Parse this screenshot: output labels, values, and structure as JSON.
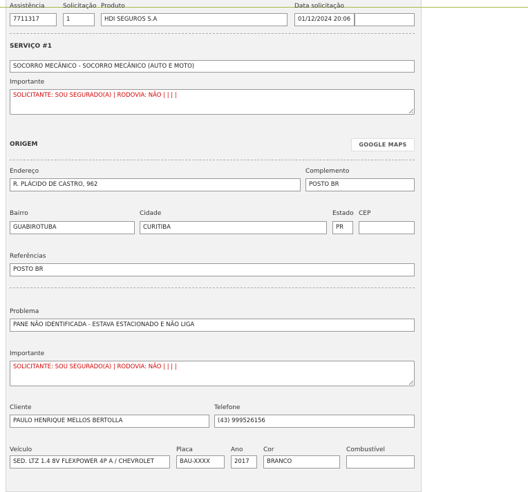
{
  "header": {
    "assistencia_label": "Assistência",
    "assistencia": "7711317",
    "solicitacao_label": "Solicitação",
    "solicitacao": "1",
    "produto_label": "Produto",
    "produto": "HDI SEGUROS S.A",
    "data_label": "Data solicitação",
    "data": "01/12/2024 20:06",
    "extra": ""
  },
  "servico": {
    "title": "SERVIÇO #1",
    "value": "SOCORRO MECÂNICO - SOCORRO MECÂNICO (AUTO E MOTO)",
    "importante_label": "Importante",
    "importante": "SOLICITANTE: SOU SEGURADO(A) | RODOVIA: NÃO |  |  |  |"
  },
  "origem": {
    "title": "ORIGEM",
    "maps_button": "GOOGLE MAPS",
    "endereco_label": "Endereço",
    "endereco": "R. PLÁCIDO DE CASTRO, 962",
    "complemento_label": "Complemento",
    "complemento": "POSTO BR",
    "bairro_label": "Bairro",
    "bairro": "GUABIROTUBA",
    "cidade_label": "Cidade",
    "cidade": "CURITIBA",
    "estado_label": "Estado",
    "estado": "PR",
    "cep_label": "CEP",
    "cep": "",
    "referencias_label": "Referências",
    "referencias": "POSTO BR"
  },
  "detalhes": {
    "problema_label": "Problema",
    "problema": "PANE NÃO IDENTIFICADA - ESTAVA ESTACIONADO E NÃO LIGA",
    "importante_label": "Importante",
    "importante": "SOLICITANTE: SOU SEGURADO(A) | RODOVIA: NÃO |  |  |  |",
    "cliente_label": "Cliente",
    "cliente": "PAULO HENRIQUE MELLOS BERTOLLA",
    "telefone_label": "Telefone",
    "telefone": "(43) 999526156",
    "veiculo_label": "Veículo",
    "veiculo": "SED. LTZ 1.4 8V FLEXPOWER 4P A / CHEVROLET",
    "placa_label": "Placa",
    "placa": "BAU-XXXX",
    "ano_label": "Ano",
    "ano": "2017",
    "cor_label": "Cor",
    "cor": "BRANCO",
    "combustivel_label": "Combustível",
    "combustivel": ""
  },
  "colors": {
    "important_text": "#d00000",
    "accent_line": "#a8b84a"
  }
}
